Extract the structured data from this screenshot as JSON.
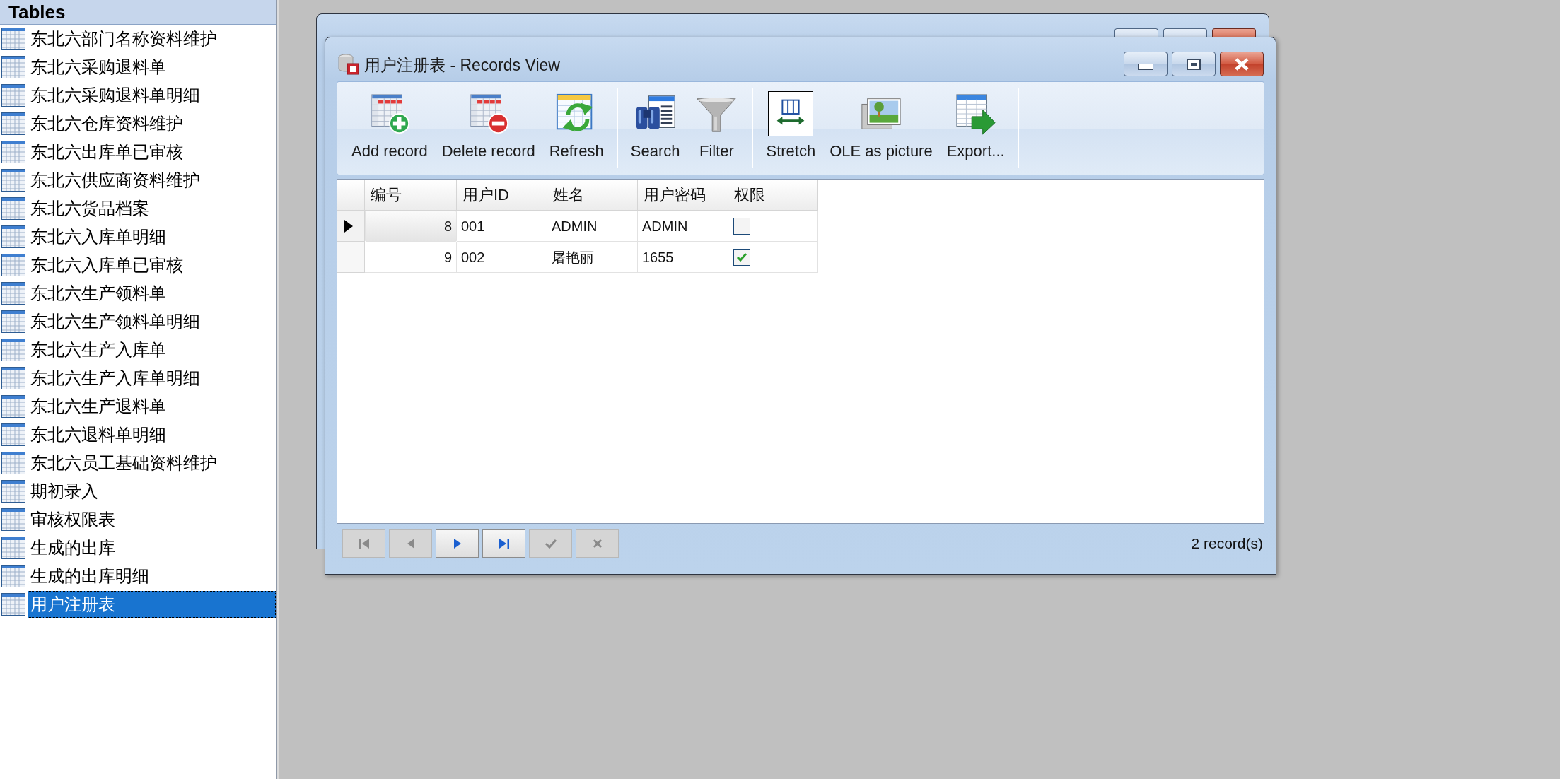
{
  "sidebar": {
    "header": "Tables",
    "items": [
      {
        "label": "东北六部门名称资料维护",
        "selected": false
      },
      {
        "label": "东北六采购退料单",
        "selected": false
      },
      {
        "label": "东北六采购退料单明细",
        "selected": false
      },
      {
        "label": "东北六仓库资料维护",
        "selected": false
      },
      {
        "label": "东北六出库单已审核",
        "selected": false
      },
      {
        "label": "东北六供应商资料维护",
        "selected": false
      },
      {
        "label": "东北六货品档案",
        "selected": false
      },
      {
        "label": "东北六入库单明细",
        "selected": false
      },
      {
        "label": "东北六入库单已审核",
        "selected": false
      },
      {
        "label": "东北六生产领料单",
        "selected": false
      },
      {
        "label": "东北六生产领料单明细",
        "selected": false
      },
      {
        "label": "东北六生产入库单",
        "selected": false
      },
      {
        "label": "东北六生产入库单明细",
        "selected": false
      },
      {
        "label": "东北六生产退料单",
        "selected": false
      },
      {
        "label": "东北六退料单明细",
        "selected": false
      },
      {
        "label": "东北六员工基础资料维护",
        "selected": false
      },
      {
        "label": "期初录入",
        "selected": false
      },
      {
        "label": "审核权限表",
        "selected": false
      },
      {
        "label": "生成的出库",
        "selected": false
      },
      {
        "label": "生成的出库明细",
        "selected": false
      },
      {
        "label": "用户注册表",
        "selected": true
      }
    ]
  },
  "window": {
    "title": "用户注册表 - Records View",
    "toolbar": [
      [
        {
          "kind": "add",
          "label": "Add record",
          "on": false
        },
        {
          "kind": "delete",
          "label": "Delete record",
          "on": false
        },
        {
          "kind": "refresh",
          "label": "Refresh",
          "on": false
        }
      ],
      [
        {
          "kind": "search",
          "label": "Search",
          "on": false
        },
        {
          "kind": "filter",
          "label": "Filter",
          "on": false
        }
      ],
      [
        {
          "kind": "stretch",
          "label": "Stretch",
          "on": true
        },
        {
          "kind": "ole",
          "label": "OLE as picture",
          "on": false
        },
        {
          "kind": "export",
          "label": "Export...",
          "on": false
        }
      ]
    ],
    "grid": {
      "columns": [
        "编号",
        "用户ID",
        "姓名",
        "用户密码",
        "权限"
      ],
      "rows": [
        {
          "current": true,
          "cells": [
            "8",
            "001",
            "ADMIN",
            "ADMIN"
          ],
          "permission": false
        },
        {
          "current": false,
          "cells": [
            "9",
            "002",
            "屠艳丽",
            "1655"
          ],
          "permission": true
        }
      ]
    },
    "navigator": [
      {
        "kind": "first",
        "disabled": true
      },
      {
        "kind": "prev",
        "disabled": true
      },
      {
        "kind": "next",
        "disabled": false
      },
      {
        "kind": "last",
        "disabled": false
      },
      {
        "kind": "post",
        "disabled": true
      },
      {
        "kind": "cancel",
        "disabled": true
      }
    ],
    "status": "2 record(s)"
  }
}
